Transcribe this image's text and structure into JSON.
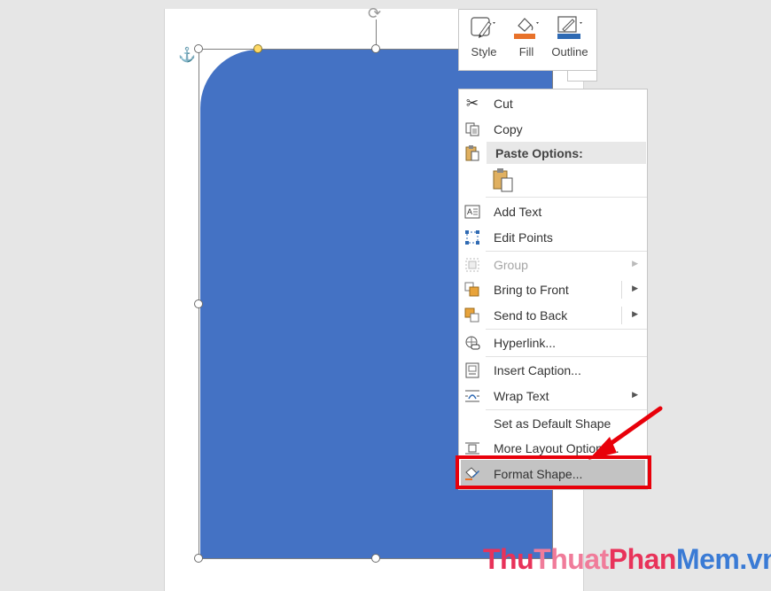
{
  "mini_toolbar": {
    "style_label": "Style",
    "fill_label": "Fill",
    "outline_label": "Outline"
  },
  "context_menu": {
    "items": [
      {
        "label": "Cut",
        "icon": "scissors-icon"
      },
      {
        "label": "Copy",
        "icon": "copy-icon"
      },
      {
        "label": "Paste Options:",
        "icon": "paste-icon"
      },
      {
        "label": "Add Text",
        "icon": "add-text-icon"
      },
      {
        "label": "Edit Points",
        "icon": "edit-points-icon"
      },
      {
        "label": "Group",
        "icon": "group-icon"
      },
      {
        "label": "Bring to Front",
        "icon": "bring-to-front-icon"
      },
      {
        "label": "Send to Back",
        "icon": "send-to-back-icon"
      },
      {
        "label": "Hyperlink...",
        "icon": "hyperlink-icon"
      },
      {
        "label": "Insert Caption...",
        "icon": "caption-icon"
      },
      {
        "label": "Wrap Text",
        "icon": "wrap-text-icon"
      },
      {
        "label": "Set as Default Shape",
        "icon": ""
      },
      {
        "label": "More Layout Options...",
        "icon": "layout-options-icon"
      },
      {
        "label": "Format Shape...",
        "icon": "format-shape-icon"
      }
    ]
  },
  "watermark": {
    "part1": "Thu",
    "part2": "Thuat",
    "part3": "Phan",
    "part4": "Mem.vn"
  },
  "colors": {
    "shape_fill": "#4472c4",
    "highlight_red": "#e8000a",
    "fill_accent": "#e8722a",
    "outline_accent": "#2f6ab3"
  }
}
